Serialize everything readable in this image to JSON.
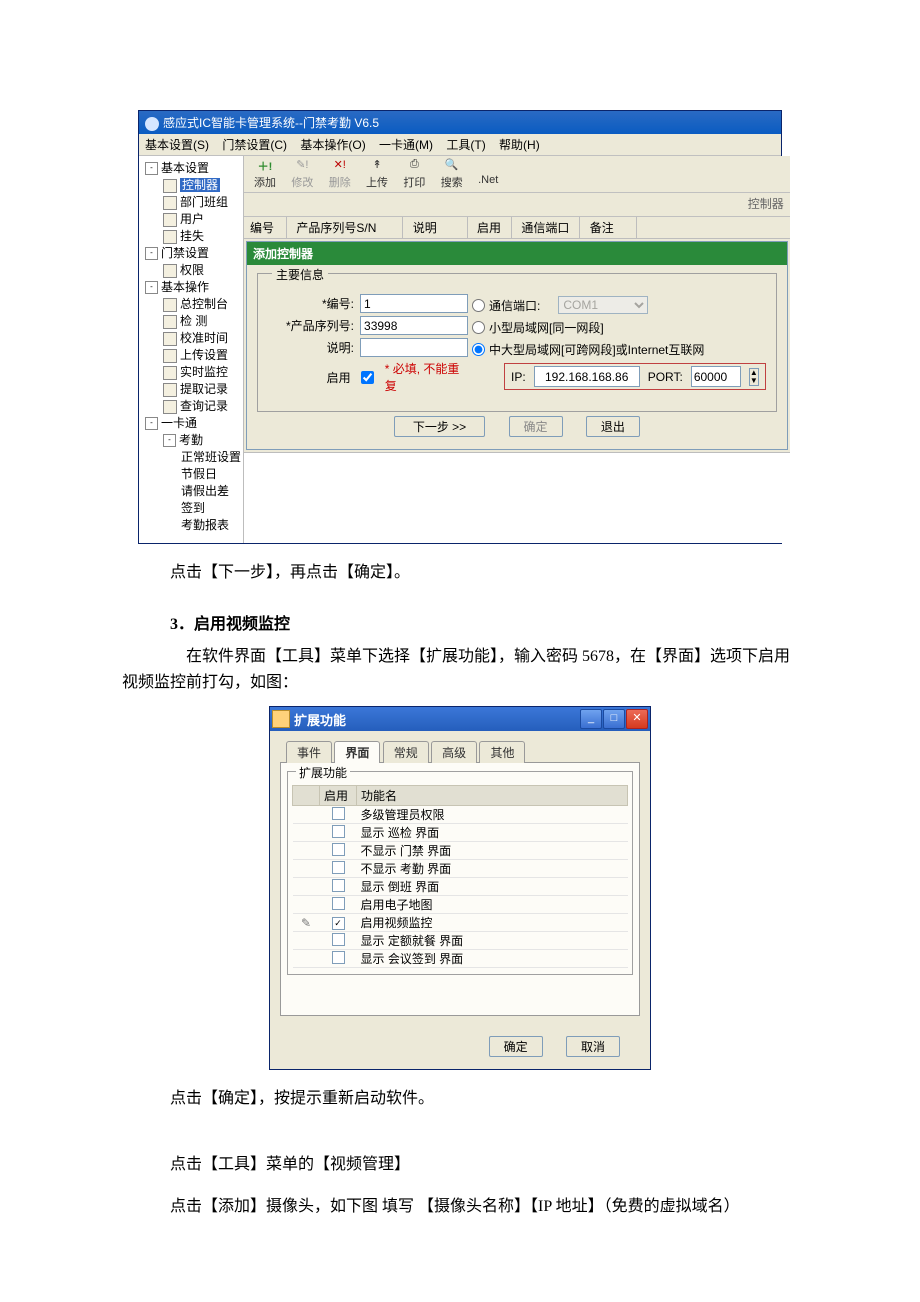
{
  "window1": {
    "title": "感应式IC智能卡管理系统--门禁考勤 V6.5",
    "menubar": [
      "基本设置(S)",
      "门禁设置(C)",
      "基本操作(O)",
      "一卡通(M)",
      "工具(T)",
      "帮助(H)"
    ],
    "tree": {
      "g1": {
        "label": "基本设置",
        "items": [
          "控制器",
          "部门班组",
          "用户",
          "挂失"
        ]
      },
      "g2": {
        "label": "门禁设置",
        "items": [
          "权限"
        ]
      },
      "g3": {
        "label": "基本操作",
        "items": [
          "总控制台",
          "检 测",
          "校准时间",
          "上传设置",
          "实时监控",
          "提取记录",
          "查询记录"
        ]
      },
      "g4": {
        "label": "一卡通",
        "sub": {
          "label": "考勤",
          "items": [
            "正常班设置",
            "节假日",
            "请假出差",
            "签到",
            "考勤报表"
          ]
        }
      }
    },
    "toolbar": {
      "add": "添加",
      "edit": "修改",
      "del": "删除",
      "upload": "上传",
      "print": "打印",
      "search": "搜索",
      "net": ".Net"
    },
    "label_right": "控制器",
    "grid": {
      "c1": "编号",
      "c2": "产品序列号S/N",
      "c3": "说明",
      "c4": "启用",
      "c5": "通信端口",
      "c6": "备注"
    }
  },
  "dialog": {
    "title": "添加控制器",
    "fs_legend": "主要信息",
    "lab_no": "*编号:",
    "val_no": "1",
    "lab_sn": "*产品序列号:",
    "val_sn": "33998",
    "lab_desc": "说明:",
    "lab_enable": "启用",
    "hint": "* 必填, 不能重复",
    "r1": "通信端口:",
    "com": "COM1",
    "r2": "小型局域网[同一网段]",
    "r3": "中大型局域网[可跨网段]或Internet互联网",
    "ip_label": "IP:",
    "ip": "192.168.168.86",
    "port_label": "PORT:",
    "port": "60000",
    "btn_next": "下一步 >>",
    "btn_ok": "确定",
    "btn_exit": "退出"
  },
  "para": {
    "p1": "点击【下一步】，再点击【确定】。",
    "h3": "3．启用视频监控",
    "p2": "在软件界面【工具】菜单下选择【扩展功能】，输入密码 5678，在【界面】选项下启用视频监控前打勾，如图：",
    "p3": "点击【确定】，按提示重新启动软件。",
    "p4": "点击【工具】菜单的【视频管理】",
    "p5": "点击【添加】摄像头，如下图 填写 【摄像头名称】【IP 地址】（免费的虚拟域名）"
  },
  "window2": {
    "title": "扩展功能",
    "tabs": [
      "事件",
      "界面",
      "常规",
      "高级",
      "其他"
    ],
    "fs": "扩展功能",
    "th1": "启用",
    "th2": "功能名",
    "features": [
      {
        "c": false,
        "n": "多级管理员权限"
      },
      {
        "c": false,
        "n": "显示 巡检 界面"
      },
      {
        "c": false,
        "n": "不显示 门禁 界面"
      },
      {
        "c": false,
        "n": "不显示 考勤 界面"
      },
      {
        "c": false,
        "n": "显示 倒班 界面"
      },
      {
        "c": false,
        "n": "启用电子地图"
      },
      {
        "c": true,
        "n": "启用视频监控",
        "edit": true
      },
      {
        "c": false,
        "n": "显示 定额就餐 界面"
      },
      {
        "c": false,
        "n": "显示 会议签到 界面"
      }
    ],
    "ok": "确定",
    "cancel": "取消"
  }
}
